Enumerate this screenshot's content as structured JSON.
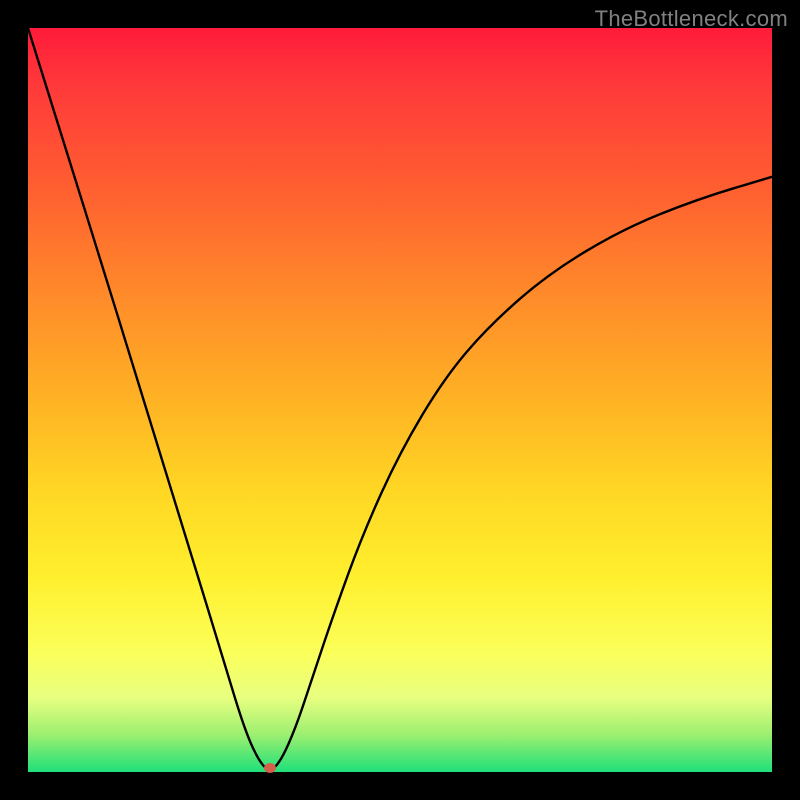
{
  "watermark": "TheBottleneck.com",
  "chart_data": {
    "type": "line",
    "title": "",
    "xlabel": "",
    "ylabel": "",
    "xlim": [
      0,
      100
    ],
    "ylim": [
      0,
      100
    ],
    "grid": false,
    "legend": false,
    "series": [
      {
        "name": "curve",
        "color": "#000000",
        "x": [
          0,
          5,
          10,
          14,
          18,
          22,
          26,
          29,
          31,
          32.5,
          34,
          36,
          38,
          41,
          45,
          50,
          56,
          62,
          70,
          80,
          90,
          100
        ],
        "values": [
          100,
          84,
          68,
          55,
          42,
          29,
          16,
          6,
          1.5,
          0,
          1.5,
          6,
          12,
          21,
          32,
          43,
          53,
          60,
          67,
          73,
          77,
          80
        ]
      }
    ],
    "marker": {
      "x": 32.5,
      "y": 0,
      "color": "#d4604b"
    },
    "note": "x and y are percent of the plot area; the minimum touches the bottom edge (y=0) at x≈32.5%"
  }
}
